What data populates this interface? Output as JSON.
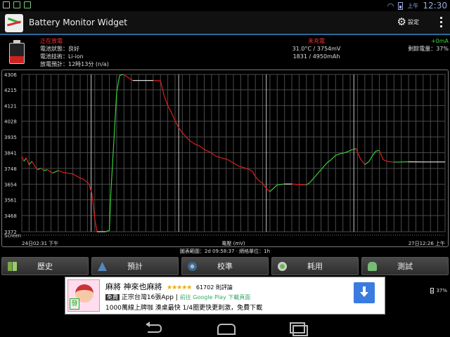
{
  "status_bar": {
    "time": "12:30",
    "ampm": "上午",
    "notification_icons": [
      "image-icon",
      "android-icon",
      "chart-icon"
    ]
  },
  "app": {
    "title": "Battery Monitor Widget",
    "settings_label": "設定"
  },
  "info": {
    "state": "正在放電",
    "health": "電池狀態：良好",
    "technology": "電池技術：Li-ion",
    "forecast": "放電預計：12時13分 (n/a)",
    "charging": "未充電",
    "temp_voltage": "31.0°C / 3754mV",
    "capacity": "1831 / 4950mAh",
    "current": "+0mA",
    "remaining": "剩餘電量：37%",
    "level": 37
  },
  "chart_caption": "圖表範圍：2d 09:58:37 · 網格單位：1h",
  "chart_data": {
    "type": "line",
    "title": "",
    "xlabel": "電壓 (mV)",
    "ylabel": "",
    "y_ticks": [
      4306,
      4215,
      4121,
      4028,
      3935,
      3841,
      3748,
      3654,
      3561,
      3468,
      3372
    ],
    "ylim": [
      3372,
      4306
    ],
    "x_start_label": "24日02:31 下午",
    "x_end_label": "27日12:26 上午",
    "x_hours_range": [
      0,
      58
    ],
    "bottom_label": "Screen",
    "colors": {
      "rising": "#36d036",
      "falling": "#e02020",
      "flat": "#e6e6e6",
      "grid": "#4a4a4a",
      "markers": "#c8c8c8"
    },
    "day_markers_hours": [
      9.5,
      21.5,
      33.5,
      45.5
    ],
    "series": [
      {
        "x": [
          0,
          0.3,
          0.6,
          1.0,
          1.4,
          1.8,
          2.2,
          2.6,
          3.0,
          3.5,
          4.2,
          5.0,
          5.6,
          6.2,
          7.0,
          7.8,
          8.6,
          9.2,
          9.6,
          10.0,
          10.3,
          10.5,
          11.5,
          12.0,
          12.2,
          12.6,
          13.0,
          13.4,
          13.9,
          14.5,
          15.2,
          16.0,
          17.0,
          18.0,
          19.0,
          19.5,
          20.0,
          20.5,
          21.0,
          21.5,
          22.0,
          22.8,
          23.6,
          24.4,
          25.0,
          25.8,
          26.6,
          27.4,
          28.2,
          29.0,
          29.8,
          30.6,
          31.2,
          31.6,
          32.0,
          32.4,
          32.8,
          33.0,
          33.3,
          33.6,
          34.0,
          34.5,
          35.0,
          36.0,
          37.0,
          38.0,
          39.0,
          39.5,
          40.0,
          40.6,
          41.2,
          41.8,
          42.4,
          43.0,
          43.6,
          44.2,
          44.8,
          45.3,
          45.8,
          46.4,
          47.0,
          47.6,
          48.0,
          48.5,
          49.0,
          49.5,
          50.0,
          51.0,
          53.0,
          55.0,
          58.0
        ],
        "y": [
          3820,
          3790,
          3810,
          3770,
          3790,
          3760,
          3740,
          3750,
          3735,
          3740,
          3720,
          3735,
          3725,
          3720,
          3715,
          3695,
          3680,
          3655,
          3600,
          3450,
          3372,
          3372,
          3372,
          3380,
          3600,
          3900,
          4200,
          4300,
          4306,
          4290,
          4270,
          4270,
          4270,
          4270,
          4268,
          4180,
          4120,
          4080,
          4030,
          3990,
          3960,
          3920,
          3895,
          3880,
          3860,
          3845,
          3820,
          3810,
          3800,
          3780,
          3760,
          3750,
          3740,
          3730,
          3700,
          3680,
          3665,
          3660,
          3640,
          3625,
          3610,
          3630,
          3650,
          3655,
          3655,
          3652,
          3650,
          3665,
          3690,
          3720,
          3750,
          3780,
          3800,
          3825,
          3835,
          3840,
          3850,
          3860,
          3865,
          3805,
          3770,
          3790,
          3820,
          3850,
          3855,
          3800,
          3790,
          3785,
          3787,
          3786,
          3786
        ]
      }
    ]
  },
  "buttons": [
    {
      "label": "歷史",
      "icon": "book-icon"
    },
    {
      "label": "預計",
      "icon": "forecast-icon"
    },
    {
      "label": "校準",
      "icon": "calibrate-icon"
    },
    {
      "label": "耗用",
      "icon": "usage-icon"
    },
    {
      "label": "測試",
      "icon": "android-icon"
    }
  ],
  "ad": {
    "title": "麻將 神來也麻將",
    "stars": "★★★★★",
    "reviews": "61702 則評論",
    "free_badge": "免費",
    "line2": "正宗台灣16張App",
    "separator": "|",
    "play_text": "前往 Google Play 下載頁面",
    "line3": "1000萬線上牌咖 湊桌最快 1/4圈更快更刺激，免費下載",
    "tile_char": "發"
  },
  "side_battery_pct": "37%"
}
